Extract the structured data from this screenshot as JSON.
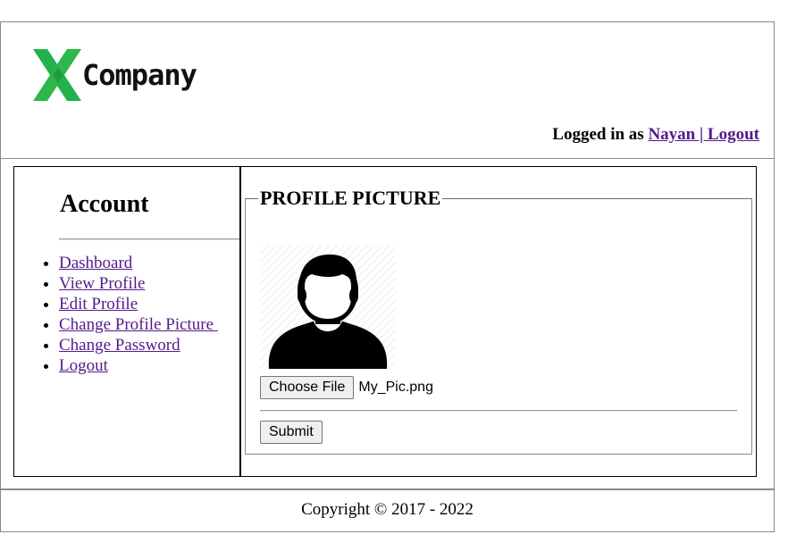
{
  "header": {
    "logo": {
      "letter": "X",
      "text": "Company"
    },
    "login": {
      "prefix": "Logged in as ",
      "user_link": "Nayan | Logout"
    }
  },
  "sidebar": {
    "title": "Account",
    "items": [
      {
        "label": "Dashboard"
      },
      {
        "label": "View Profile"
      },
      {
        "label": "Edit Profile"
      },
      {
        "label": "Change Profile Picture "
      },
      {
        "label": "Change Password"
      },
      {
        "label": "Logout"
      }
    ]
  },
  "main": {
    "legend": "PROFILE PICTURE",
    "file_button": "Choose File",
    "file_name": "My_Pic.png",
    "submit": "Submit"
  },
  "footer": {
    "copyright": "Copyright © 2017 - 2022"
  },
  "colors": {
    "logo_green": "#22b14c",
    "link": "#551a8b"
  },
  "icons": {
    "avatar": "user-silhouette-icon"
  }
}
